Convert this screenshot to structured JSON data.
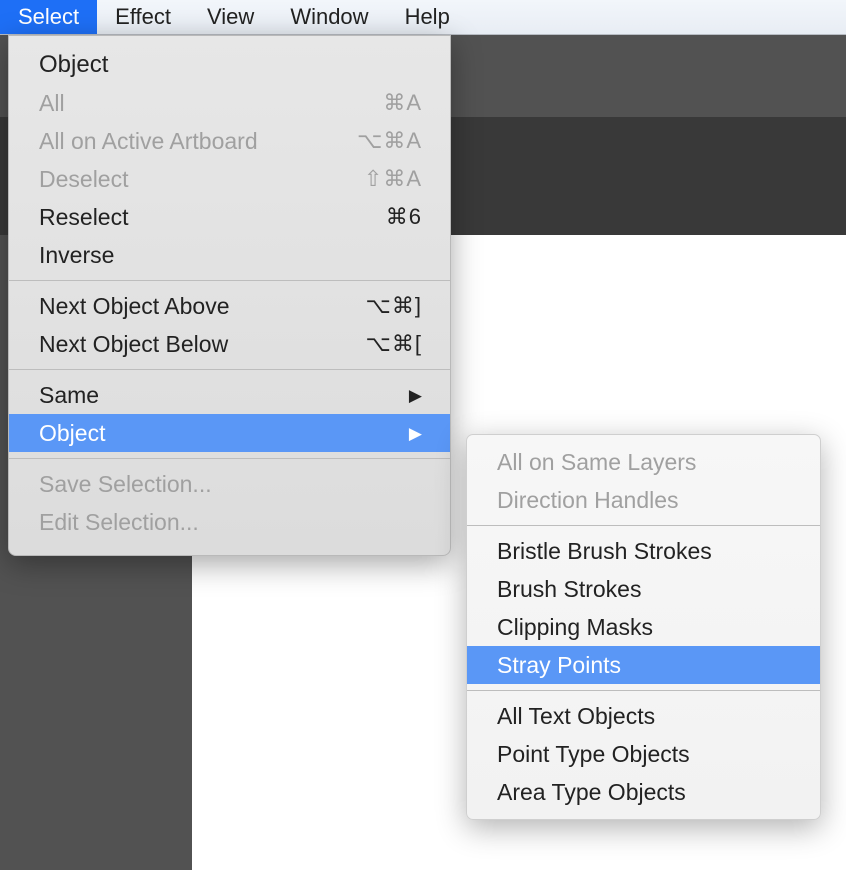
{
  "menubar": {
    "select": "Select",
    "effect": "Effect",
    "view": "View",
    "window": "Window",
    "help": "Help"
  },
  "menu": {
    "object_header": "Object",
    "all": {
      "label": "All",
      "shortcut": "⌘A"
    },
    "all_artboard": {
      "label": "All on Active Artboard",
      "shortcut": "⌥⌘A"
    },
    "deselect": {
      "label": "Deselect",
      "shortcut": "⇧⌘A"
    },
    "reselect": {
      "label": "Reselect",
      "shortcut": "⌘6"
    },
    "inverse": {
      "label": "Inverse"
    },
    "next_above": {
      "label": "Next Object Above",
      "shortcut": "⌥⌘]"
    },
    "next_below": {
      "label": "Next Object Below",
      "shortcut": "⌥⌘["
    },
    "same": {
      "label": "Same"
    },
    "object_sub": {
      "label": "Object"
    },
    "save_selection": {
      "label": "Save Selection..."
    },
    "edit_selection": {
      "label": "Edit Selection..."
    }
  },
  "submenu": {
    "all_same_layers": "All on Same Layers",
    "direction_handles": "Direction Handles",
    "bristle_brush": "Bristle Brush Strokes",
    "brush_strokes": "Brush Strokes",
    "clipping_masks": "Clipping Masks",
    "stray_points": "Stray Points",
    "all_text_objects": "All Text Objects",
    "point_type_objects": "Point Type Objects",
    "area_type_objects": "Area Type Objects"
  }
}
